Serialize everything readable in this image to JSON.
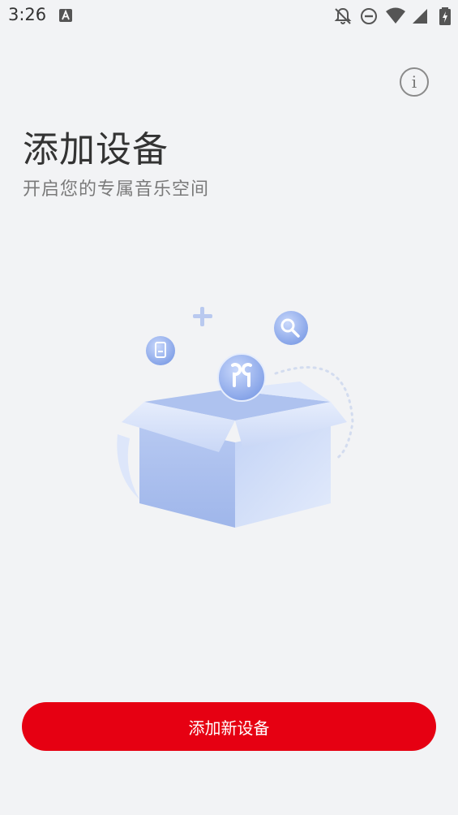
{
  "status_bar": {
    "time": "3:26",
    "icons": [
      "app-a-icon",
      "notifications-off-icon",
      "do-not-disturb-icon",
      "wifi-icon",
      "signal-icon",
      "battery-charging-icon"
    ]
  },
  "header": {
    "info_icon": "info-icon",
    "info_glyph": "i",
    "title": "添加设备",
    "subtitle": "开启您的专属音乐空间"
  },
  "illustration": {
    "icons": [
      "box-illustration",
      "earbuds-icon",
      "search-icon",
      "plus-icon",
      "device-icon"
    ]
  },
  "actions": {
    "add_device_label": "添加新设备"
  },
  "colors": {
    "background": "#f2f3f5",
    "accent": "#e60012",
    "box_blue": "#a9c0f0"
  }
}
